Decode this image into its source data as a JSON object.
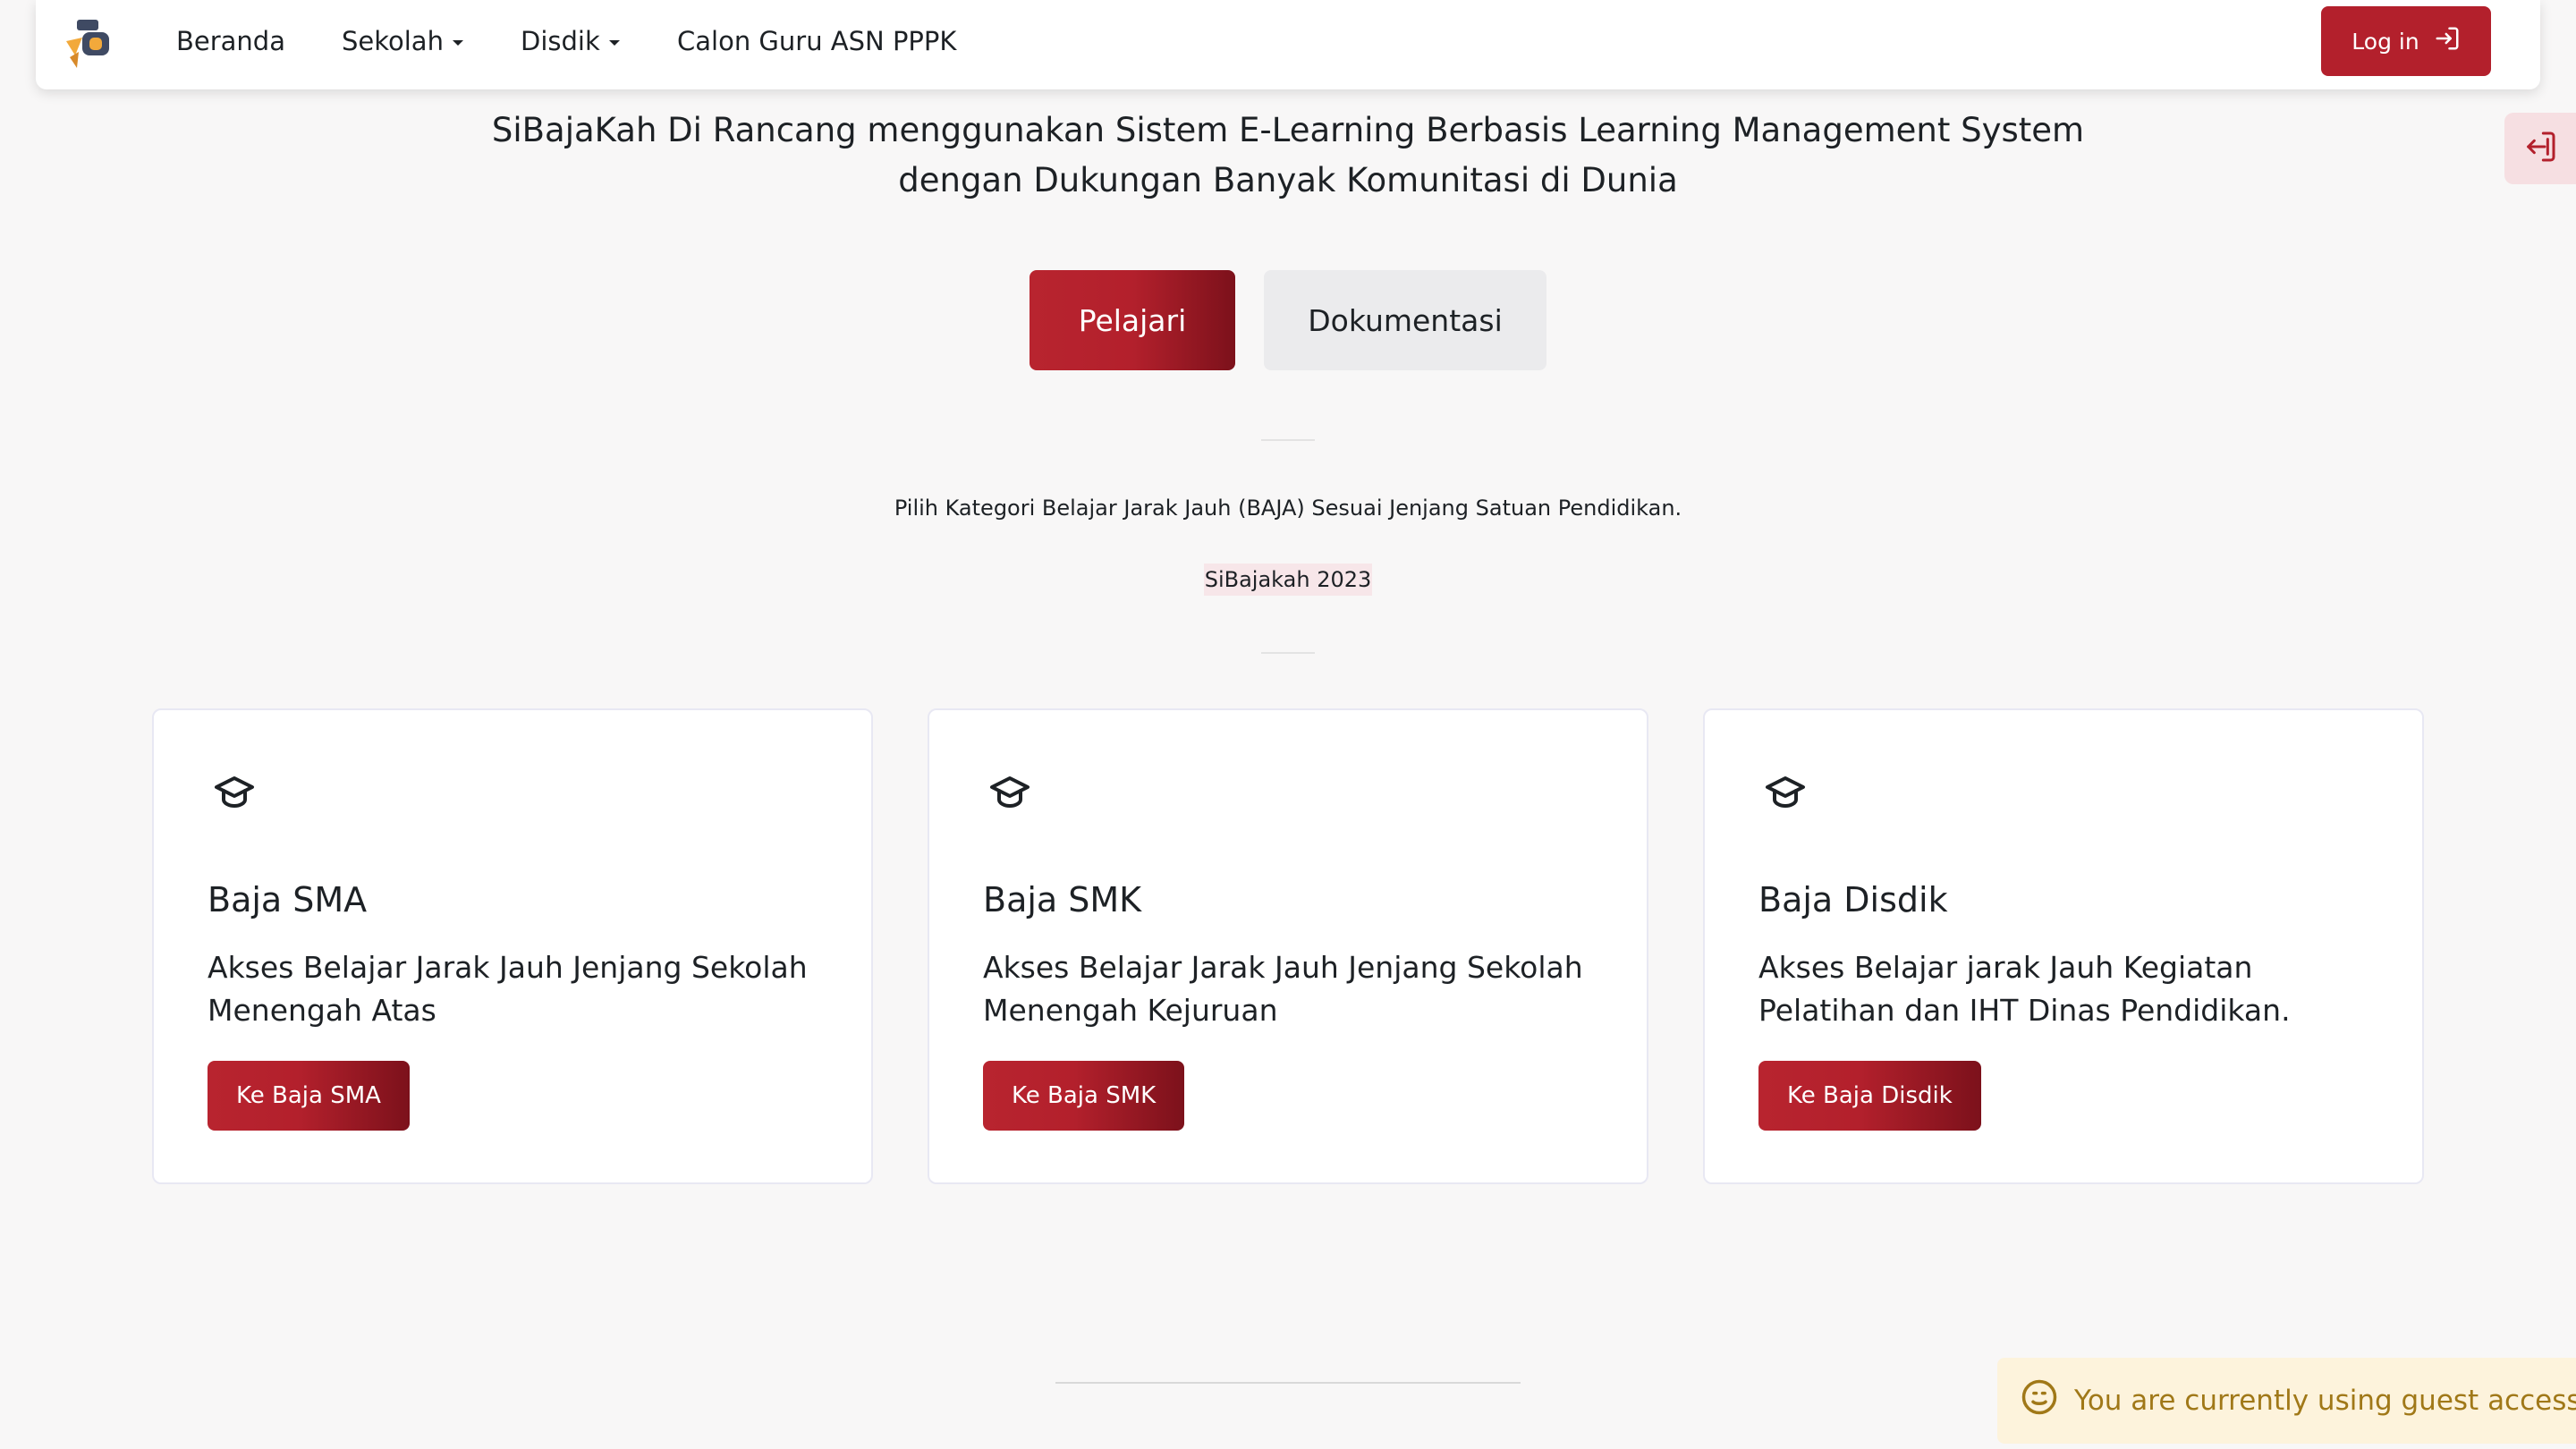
{
  "nav": {
    "items": [
      {
        "label": "Beranda",
        "dropdown": false
      },
      {
        "label": "Sekolah",
        "dropdown": true
      },
      {
        "label": "Disdik",
        "dropdown": true
      },
      {
        "label": "Calon Guru ASN PPPK",
        "dropdown": false
      }
    ],
    "login_label": "Log in"
  },
  "hero": {
    "line1": "SiBajaKah Di Rancang menggunakan Sistem E-Learning Berbasis Learning Management System",
    "line2": "dengan Dukungan Banyak Komunitasi di Dunia",
    "primary_button": "Pelajari",
    "secondary_button": "Dokumentasi"
  },
  "intro": {
    "subtitle": "Pilih Kategori Belajar Jarak Jauh (BAJA) Sesuai Jenjang Satuan Pendidikan.",
    "year_badge": "SiBajakah 2023"
  },
  "cards": [
    {
      "icon": "graduation-cap-icon",
      "title": "Baja SMA",
      "description": "Akses Belajar Jarak Jauh Jenjang Sekolah Menengah Atas",
      "button": "Ke Baja SMA"
    },
    {
      "icon": "graduation-cap-icon",
      "title": "Baja SMK",
      "description": "Akses Belajar Jarak Jauh Jenjang Sekolah Menengah Kejuruan",
      "button": "Ke Baja SMK"
    },
    {
      "icon": "graduation-cap-icon",
      "title": "Baja Disdik",
      "description": "Akses Belajar jarak Jauh Kegiatan Pelatihan dan IHT Dinas Pendidikan.",
      "button": "Ke Baja Disdik"
    }
  ],
  "guest_notice": "You are currently using guest access",
  "colors": {
    "accent": "#b3202c",
    "accent_dark": "#7c111b",
    "background": "#f8f7f7",
    "notice_bg": "#fdf3dc",
    "notice_text": "#a07818"
  }
}
